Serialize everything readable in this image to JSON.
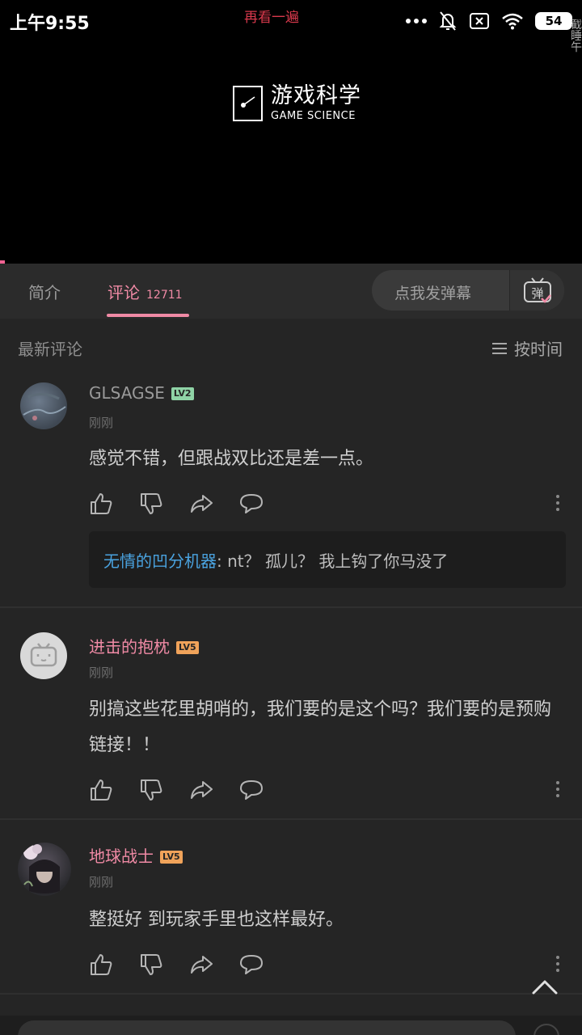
{
  "status_bar": {
    "time": "上午9:55",
    "replay_label": "再看一遍",
    "battery": "54",
    "edge_text": "截睡午"
  },
  "video": {
    "logo_cn": "游戏科学",
    "logo_en": "GAME SCIENCE"
  },
  "tabs": {
    "intro": "简介",
    "comments": "评论",
    "comments_count": "12711",
    "danmaku_placeholder": "点我发弹幕",
    "danmaku_icon_char": "弹"
  },
  "sort": {
    "label": "最新评论",
    "button": "按时间"
  },
  "comments": [
    {
      "username": "GLSAGSE",
      "level": "LV2",
      "level_color": "#8fd3a6",
      "name_color": "#9a9a9a",
      "time": "刚刚",
      "text": "感觉不错，但跟战双比还是差一点。",
      "reply": {
        "user": "无情的凹分机器",
        "text": ": nt？ 孤儿？ 我上钩了你马没了"
      }
    },
    {
      "username": "进击的抱枕",
      "level": "LV5",
      "level_color": "#f0a35a",
      "name_color": "#f08aa5",
      "time": "刚刚",
      "text": "别搞这些花里胡哨的，我们要的是这个吗？我们要的是预购链接！！"
    },
    {
      "username": "地球战士",
      "level": "LV5",
      "level_color": "#f0a35a",
      "name_color": "#f08aa5",
      "time": "刚刚",
      "text": "整挺好 到玩家手里也这样最好。"
    }
  ]
}
